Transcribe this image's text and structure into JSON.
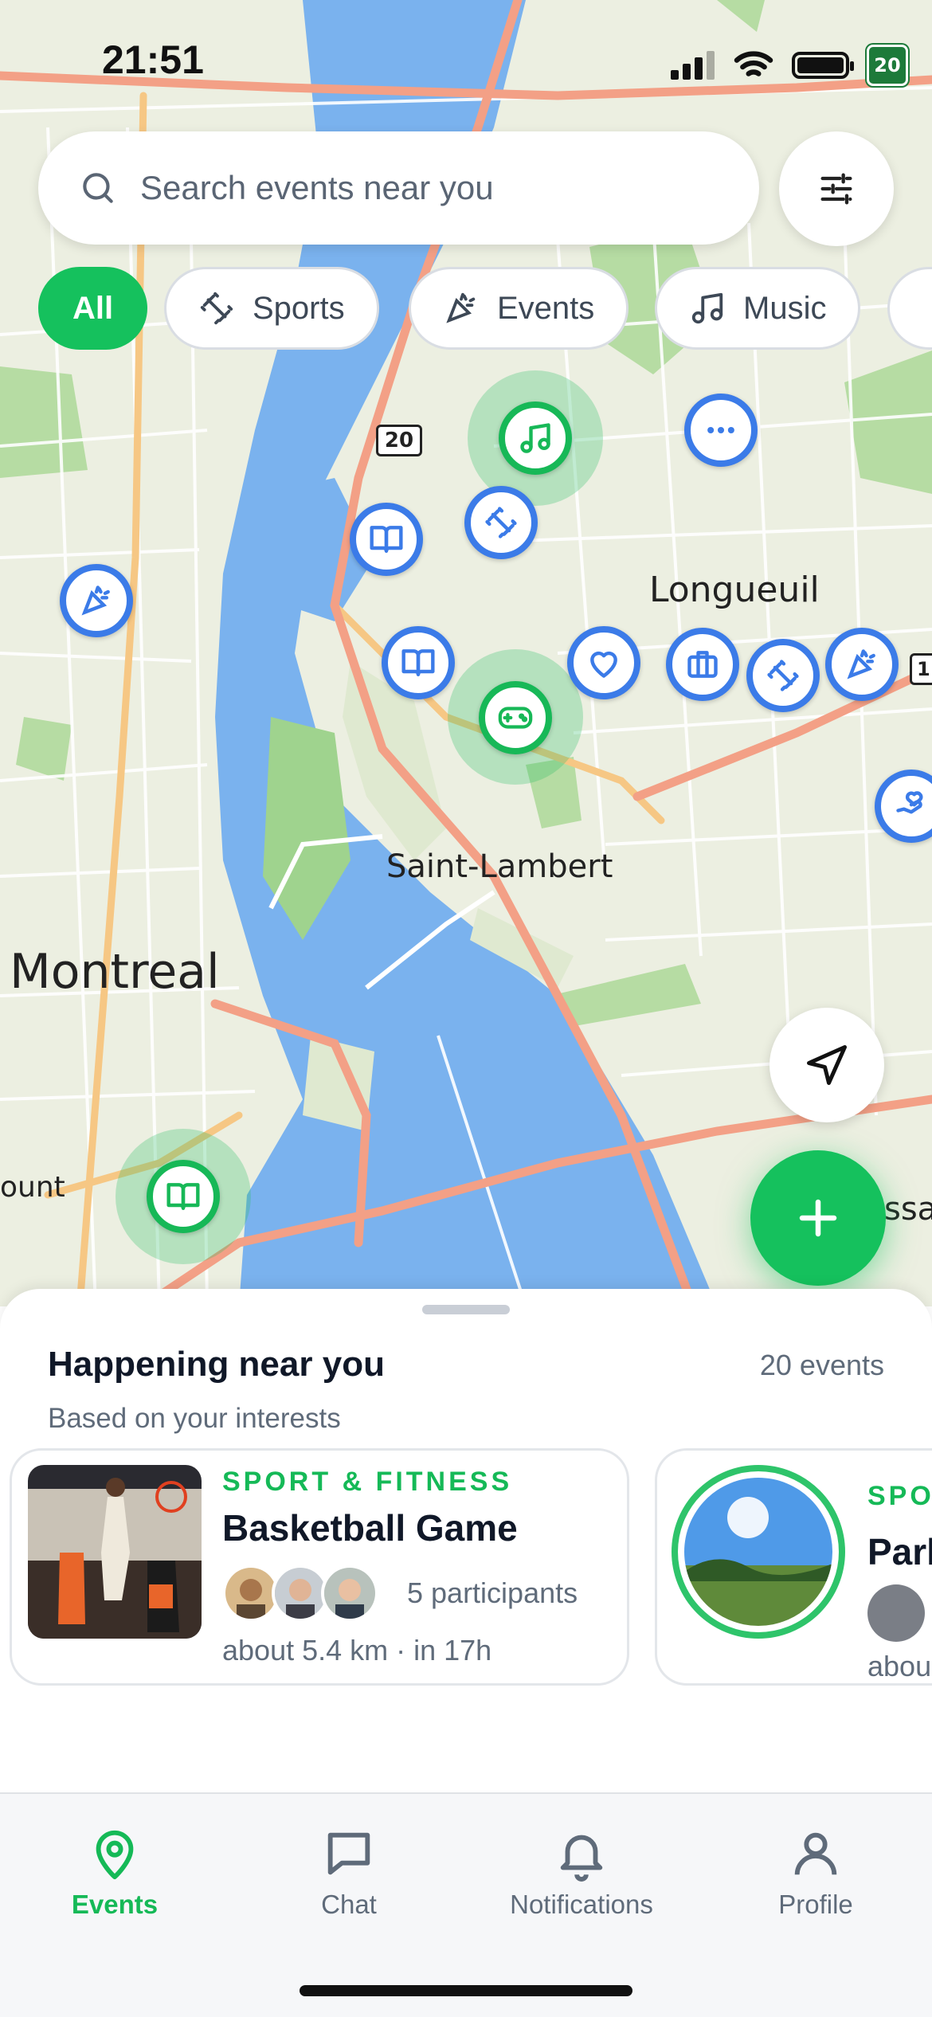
{
  "status_bar": {
    "time": "21:51",
    "route_badge": "20"
  },
  "search": {
    "placeholder": "Search events near you"
  },
  "filters": [
    {
      "label": "All",
      "icon": "none",
      "active": true
    },
    {
      "label": "Sports",
      "icon": "dumbbell-icon",
      "active": false
    },
    {
      "label": "Events",
      "icon": "party-popper-icon",
      "active": false
    },
    {
      "label": "Music",
      "icon": "music-note-icon",
      "active": false
    }
  ],
  "map": {
    "labels": {
      "montreal": "Montreal",
      "longueuil": "Longueuil",
      "saint_lambert": "Saint-Lambert",
      "mount": "ount",
      "ssa": "ssa"
    },
    "route_shield": "20",
    "route_shield_right": "1",
    "colors": {
      "land": "#ecefe1",
      "water": "#7ab2ee",
      "highway": "#f3a086",
      "arterial": "#f6c784",
      "park": "#a9d99c"
    }
  },
  "sheet": {
    "title": "Happening near you",
    "subtitle": "Based on your interests",
    "count": "20 events",
    "cards": [
      {
        "category": "SPORT & FITNESS",
        "title": "Basketball Game",
        "participants": "5 participants",
        "meta": "about 5.4 km · in 17h"
      },
      {
        "category": "SPO",
        "title": "Parl",
        "meta": "abou"
      }
    ]
  },
  "tabs": [
    {
      "label": "Events",
      "icon": "map-pin-icon",
      "active": true
    },
    {
      "label": "Chat",
      "icon": "chat-bubble-icon",
      "active": false
    },
    {
      "label": "Notifications",
      "icon": "bell-icon",
      "active": false
    },
    {
      "label": "Profile",
      "icon": "user-icon",
      "active": false
    }
  ],
  "accent_color": "#15c15d",
  "marker_blue": "#3b7be8"
}
